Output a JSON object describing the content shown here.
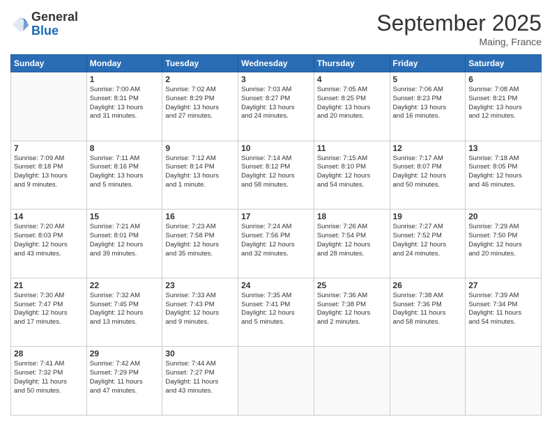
{
  "logo": {
    "general": "General",
    "blue": "Blue"
  },
  "title": "September 2025",
  "location": "Maing, France",
  "days_header": [
    "Sunday",
    "Monday",
    "Tuesday",
    "Wednesday",
    "Thursday",
    "Friday",
    "Saturday"
  ],
  "weeks": [
    [
      {
        "day": "",
        "info": ""
      },
      {
        "day": "1",
        "info": "Sunrise: 7:00 AM\nSunset: 8:31 PM\nDaylight: 13 hours\nand 31 minutes."
      },
      {
        "day": "2",
        "info": "Sunrise: 7:02 AM\nSunset: 8:29 PM\nDaylight: 13 hours\nand 27 minutes."
      },
      {
        "day": "3",
        "info": "Sunrise: 7:03 AM\nSunset: 8:27 PM\nDaylight: 13 hours\nand 24 minutes."
      },
      {
        "day": "4",
        "info": "Sunrise: 7:05 AM\nSunset: 8:25 PM\nDaylight: 13 hours\nand 20 minutes."
      },
      {
        "day": "5",
        "info": "Sunrise: 7:06 AM\nSunset: 8:23 PM\nDaylight: 13 hours\nand 16 minutes."
      },
      {
        "day": "6",
        "info": "Sunrise: 7:08 AM\nSunset: 8:21 PM\nDaylight: 13 hours\nand 12 minutes."
      }
    ],
    [
      {
        "day": "7",
        "info": "Sunrise: 7:09 AM\nSunset: 8:18 PM\nDaylight: 13 hours\nand 9 minutes."
      },
      {
        "day": "8",
        "info": "Sunrise: 7:11 AM\nSunset: 8:16 PM\nDaylight: 13 hours\nand 5 minutes."
      },
      {
        "day": "9",
        "info": "Sunrise: 7:12 AM\nSunset: 8:14 PM\nDaylight: 13 hours\nand 1 minute."
      },
      {
        "day": "10",
        "info": "Sunrise: 7:14 AM\nSunset: 8:12 PM\nDaylight: 12 hours\nand 58 minutes."
      },
      {
        "day": "11",
        "info": "Sunrise: 7:15 AM\nSunset: 8:10 PM\nDaylight: 12 hours\nand 54 minutes."
      },
      {
        "day": "12",
        "info": "Sunrise: 7:17 AM\nSunset: 8:07 PM\nDaylight: 12 hours\nand 50 minutes."
      },
      {
        "day": "13",
        "info": "Sunrise: 7:18 AM\nSunset: 8:05 PM\nDaylight: 12 hours\nand 46 minutes."
      }
    ],
    [
      {
        "day": "14",
        "info": "Sunrise: 7:20 AM\nSunset: 8:03 PM\nDaylight: 12 hours\nand 43 minutes."
      },
      {
        "day": "15",
        "info": "Sunrise: 7:21 AM\nSunset: 8:01 PM\nDaylight: 12 hours\nand 39 minutes."
      },
      {
        "day": "16",
        "info": "Sunrise: 7:23 AM\nSunset: 7:58 PM\nDaylight: 12 hours\nand 35 minutes."
      },
      {
        "day": "17",
        "info": "Sunrise: 7:24 AM\nSunset: 7:56 PM\nDaylight: 12 hours\nand 32 minutes."
      },
      {
        "day": "18",
        "info": "Sunrise: 7:26 AM\nSunset: 7:54 PM\nDaylight: 12 hours\nand 28 minutes."
      },
      {
        "day": "19",
        "info": "Sunrise: 7:27 AM\nSunset: 7:52 PM\nDaylight: 12 hours\nand 24 minutes."
      },
      {
        "day": "20",
        "info": "Sunrise: 7:29 AM\nSunset: 7:50 PM\nDaylight: 12 hours\nand 20 minutes."
      }
    ],
    [
      {
        "day": "21",
        "info": "Sunrise: 7:30 AM\nSunset: 7:47 PM\nDaylight: 12 hours\nand 17 minutes."
      },
      {
        "day": "22",
        "info": "Sunrise: 7:32 AM\nSunset: 7:45 PM\nDaylight: 12 hours\nand 13 minutes."
      },
      {
        "day": "23",
        "info": "Sunrise: 7:33 AM\nSunset: 7:43 PM\nDaylight: 12 hours\nand 9 minutes."
      },
      {
        "day": "24",
        "info": "Sunrise: 7:35 AM\nSunset: 7:41 PM\nDaylight: 12 hours\nand 5 minutes."
      },
      {
        "day": "25",
        "info": "Sunrise: 7:36 AM\nSunset: 7:38 PM\nDaylight: 12 hours\nand 2 minutes."
      },
      {
        "day": "26",
        "info": "Sunrise: 7:38 AM\nSunset: 7:36 PM\nDaylight: 11 hours\nand 58 minutes."
      },
      {
        "day": "27",
        "info": "Sunrise: 7:39 AM\nSunset: 7:34 PM\nDaylight: 11 hours\nand 54 minutes."
      }
    ],
    [
      {
        "day": "28",
        "info": "Sunrise: 7:41 AM\nSunset: 7:32 PM\nDaylight: 11 hours\nand 50 minutes."
      },
      {
        "day": "29",
        "info": "Sunrise: 7:42 AM\nSunset: 7:29 PM\nDaylight: 11 hours\nand 47 minutes."
      },
      {
        "day": "30",
        "info": "Sunrise: 7:44 AM\nSunset: 7:27 PM\nDaylight: 11 hours\nand 43 minutes."
      },
      {
        "day": "",
        "info": ""
      },
      {
        "day": "",
        "info": ""
      },
      {
        "day": "",
        "info": ""
      },
      {
        "day": "",
        "info": ""
      }
    ]
  ]
}
